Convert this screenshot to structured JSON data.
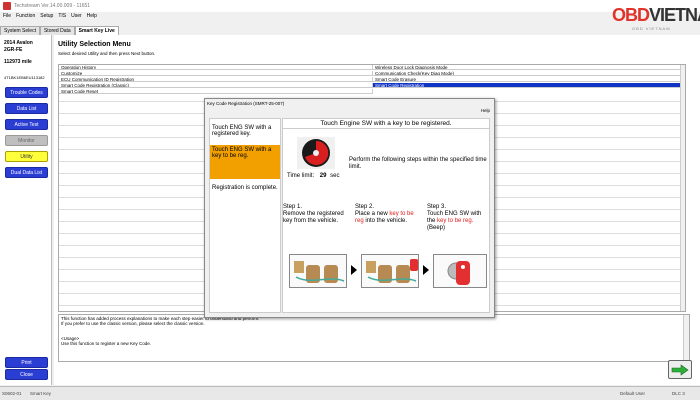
{
  "titlebar": {
    "title": "Techstream Ver.14.00.009 - 11651"
  },
  "logo": {
    "part1": "OBD",
    "part2": "VIETNAM",
    "tagline": "OBD VIETNAM"
  },
  "menu": [
    "File",
    "Function",
    "Setup",
    "TIS",
    "User",
    "Help"
  ],
  "tabs": [
    "System Select",
    "Stored Data",
    "Smart Key Live"
  ],
  "vehicle": {
    "line1": "2014 Avalon",
    "line2": "2GR-FE",
    "line3": "112973 mile",
    "vin": "4T1BK1EB6EU113182"
  },
  "sidebar": [
    "Trouble Codes",
    "Data List",
    "Active Test",
    "Monitor",
    "Utility",
    "Dual Data List"
  ],
  "sidebar_bottom": [
    "Print",
    "Close"
  ],
  "main": {
    "title": "Utility Selection Menu",
    "subtitle": "Select desired Utility and then press Next button."
  },
  "utilities_left": [
    "Operation History",
    "Customize",
    "ECU Communication ID Registration",
    "Smart Code Registration (Classic)",
    "Smart Code Reset"
  ],
  "utilities_right": [
    "Wireless Door Lock Diagnosis Mode",
    "Communication Check(Key Diag Mode)",
    "Smart Code Erasure",
    "Smart Code Registration"
  ],
  "description": {
    "line1": "This function has added process explanations to make each step easier to understand and perform.",
    "line2": "If you prefer to use the classic version, please select the classic version.",
    "line3": "<Usage>",
    "line4": "Use this function to register a new Key Code."
  },
  "dialog": {
    "title": "Key Code Registration (SMRT-25-007)",
    "help": "Help",
    "steps": [
      "Touch ENG SW with a registered key.",
      "Touch ENG SW with a key to be reg.",
      "Registration is complete."
    ],
    "header": "Touch Engine SW with a key to be registered.",
    "time_label": "Time limit:",
    "time_value": "29",
    "time_unit": "sec",
    "instruction": "Perform the following steps within the specified time limit.",
    "step1_title": "Step 1.",
    "step1_text": "Remove the registered key from the vehicle.",
    "step2_title": "Step 2.",
    "step2_pre": "Place a new",
    "step2_red": "key to be reg",
    "step2_post": "into the vehicle.",
    "step3_title": "Step 3.",
    "step3_pre": "Touch ENG SW with the",
    "step3_red": "key to be reg.",
    "step3_post": "(Beep)"
  },
  "statusbar": {
    "left": "S0602-01",
    "mid": "Smart Key",
    "user": "Default User",
    "dlc": "DLC 3"
  },
  "colors": {
    "sidebar_button": "#2b3ed4",
    "selected_row": "#1034c4",
    "current_step": "#f2a000",
    "logo_red": "#e0342b"
  }
}
